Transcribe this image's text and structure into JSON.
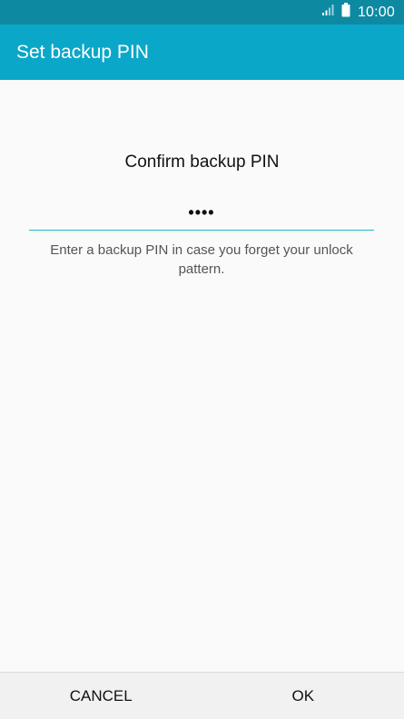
{
  "status_bar": {
    "time": "10:00",
    "icons": [
      "signal-icon",
      "battery-icon"
    ]
  },
  "app_bar": {
    "title": "Set backup PIN"
  },
  "main": {
    "prompt": "Confirm backup PIN",
    "pin_field": {
      "value": "••••"
    },
    "helper_text": "Enter a backup PIN in case you forget your unlock pattern."
  },
  "bottom_bar": {
    "cancel_label": "CANCEL",
    "ok_label": "OK"
  },
  "colors": {
    "status_bar": "#0d8aa2",
    "app_bar": "#0ba7c9",
    "accent": "#21b8c9",
    "background": "#fafafa"
  }
}
